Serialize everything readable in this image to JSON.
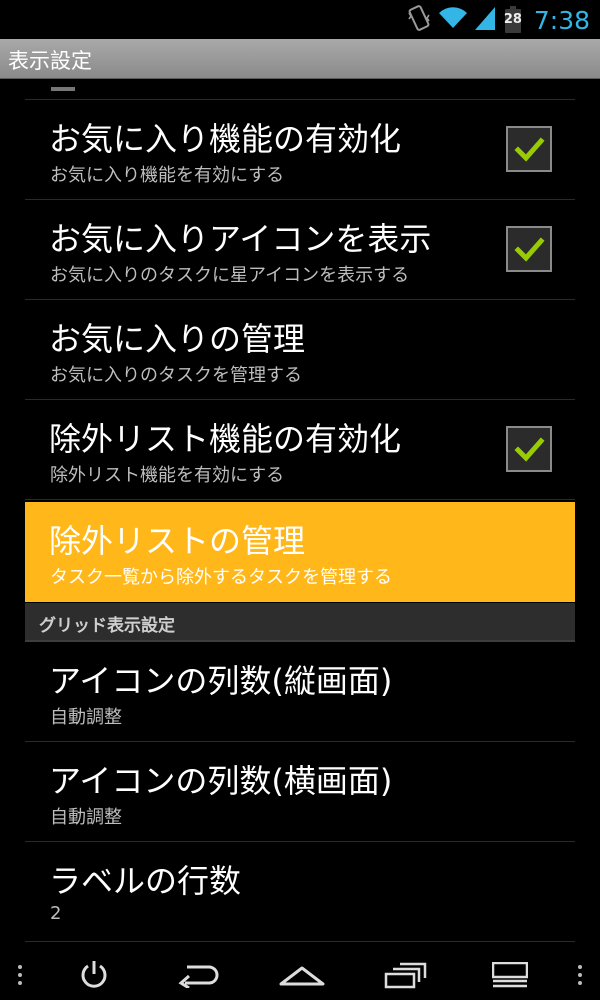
{
  "status_bar": {
    "time": "7:38",
    "battery_level": "28",
    "icons": [
      "vibrate-icon",
      "wifi-icon",
      "signal-icon",
      "battery-icon"
    ],
    "accent_color": "#33b5e5"
  },
  "title_bar": {
    "title": "表示設定"
  },
  "settings": [
    {
      "title": "お気に入り機能の有効化",
      "summary": "お気に入り機能を有効にする",
      "checkbox": true,
      "checked": true
    },
    {
      "title": "お気に入りアイコンを表示",
      "summary": "お気に入りのタスクに星アイコンを表示する",
      "checkbox": true,
      "checked": true
    },
    {
      "title": "お気に入りの管理",
      "summary": "お気に入りのタスクを管理する",
      "checkbox": false
    },
    {
      "title": "除外リスト機能の有効化",
      "summary": "除外リスト機能を有効にする",
      "checkbox": true,
      "checked": true
    },
    {
      "title": "除外リストの管理",
      "summary": "タスク一覧から除外するタスクを管理する",
      "checkbox": false,
      "highlighted": true
    }
  ],
  "section_header": "グリッド表示設定",
  "grid_settings": [
    {
      "title": "アイコンの列数(縦画面)",
      "summary": "自動調整"
    },
    {
      "title": "アイコンの列数(横画面)",
      "summary": "自動調整"
    },
    {
      "title": "ラベルの行数",
      "summary": "2"
    }
  ],
  "colors": {
    "highlight": "#ffb71a",
    "check": "#99cc00"
  },
  "nav_bar": [
    "menu-dots-icon",
    "power-icon",
    "back-icon",
    "home-icon",
    "recent-apps-icon",
    "menu-icon",
    "menu-dots-icon"
  ]
}
